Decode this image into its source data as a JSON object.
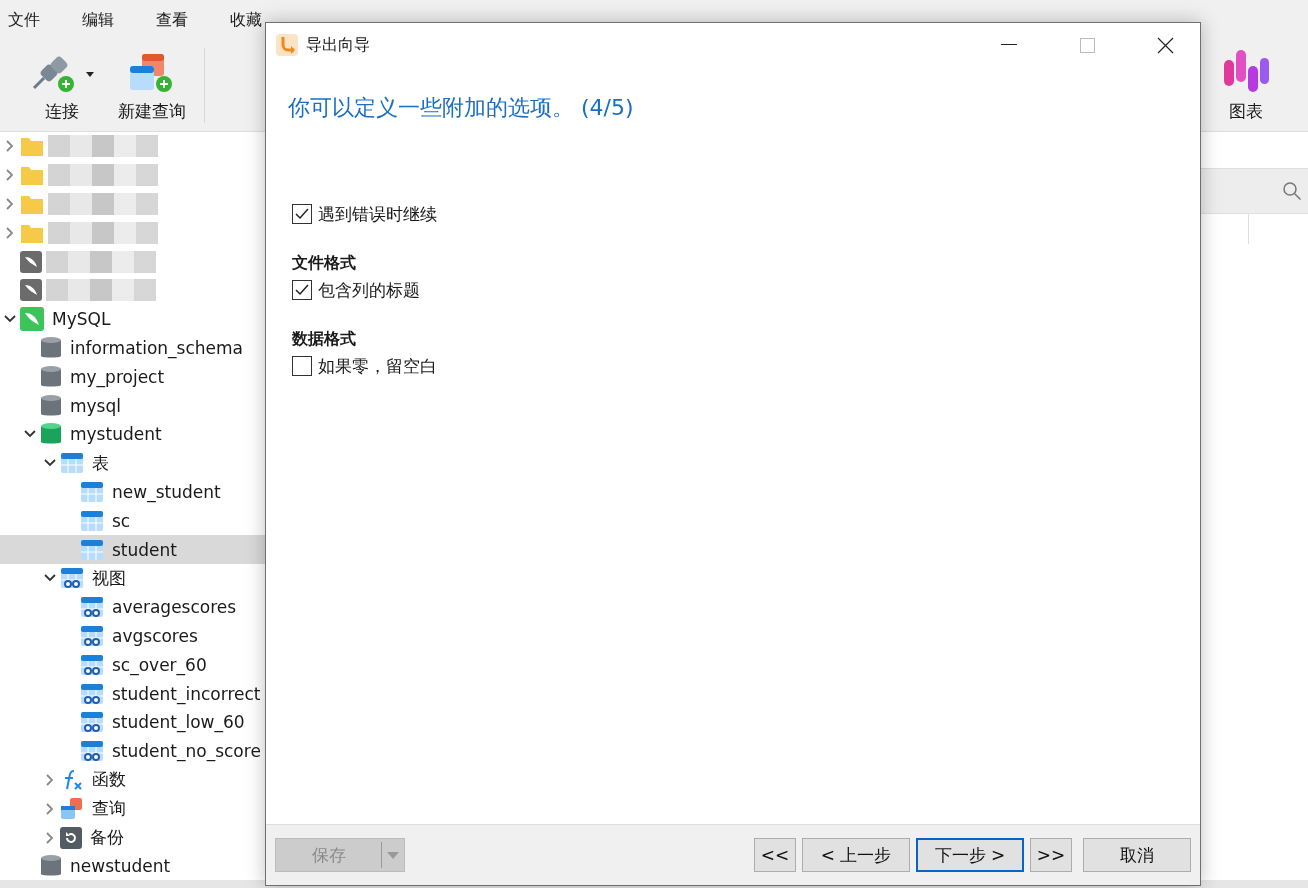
{
  "menu": [
    "文件",
    "编辑",
    "查看",
    "收藏"
  ],
  "toolbar": [
    {
      "label": "连接",
      "kind": "connect",
      "dropdown": true
    },
    {
      "label": "新建查询",
      "kind": "query",
      "dropdown": false
    },
    {
      "label": "图表",
      "kind": "chart",
      "dropdown": false
    }
  ],
  "tree": [
    {
      "kind": "redacted-folder",
      "expanded": false,
      "selected": false
    },
    {
      "kind": "redacted-folder",
      "expanded": false,
      "selected": false
    },
    {
      "kind": "redacted-folder",
      "expanded": false,
      "selected": false
    },
    {
      "kind": "redacted-folder",
      "expanded": false,
      "selected": false
    },
    {
      "kind": "redacted-connection",
      "selected": false
    },
    {
      "kind": "redacted-connection",
      "selected": false
    },
    {
      "kind": "mysql",
      "label": "MySQL",
      "expanded": true,
      "selected": false,
      "children": [
        {
          "kind": "database",
          "label": "information_schema",
          "selected": false
        },
        {
          "kind": "database",
          "label": "my_project",
          "selected": false
        },
        {
          "kind": "database",
          "label": "mysql",
          "selected": false
        },
        {
          "kind": "database-open",
          "label": "mystudent",
          "expanded": true,
          "selected": false,
          "children": [
            {
              "kind": "tables",
              "label": "表",
              "expanded": true,
              "selected": false,
              "children": [
                {
                  "kind": "table",
                  "label": "new_student",
                  "selected": false
                },
                {
                  "kind": "table",
                  "label": "sc",
                  "selected": false
                },
                {
                  "kind": "table",
                  "label": "student",
                  "selected": true
                }
              ]
            },
            {
              "kind": "views",
              "label": "视图",
              "expanded": true,
              "selected": false,
              "children": [
                {
                  "kind": "view",
                  "label": "averagescores",
                  "selected": false
                },
                {
                  "kind": "view",
                  "label": "avgscores",
                  "selected": false
                },
                {
                  "kind": "view",
                  "label": "sc_over_60",
                  "selected": false
                },
                {
                  "kind": "view",
                  "label": "student_incorrect",
                  "selected": false
                },
                {
                  "kind": "view",
                  "label": "student_low_60",
                  "selected": false
                },
                {
                  "kind": "view",
                  "label": "student_no_score",
                  "selected": false
                }
              ]
            },
            {
              "kind": "functions",
              "label": "函数",
              "expanded": false,
              "selected": false
            },
            {
              "kind": "queries",
              "label": "查询",
              "expanded": false,
              "selected": false
            },
            {
              "kind": "backups",
              "label": "备份",
              "expanded": false,
              "selected": false
            }
          ]
        },
        {
          "kind": "database",
          "label": "newstudent",
          "selected": false
        }
      ]
    }
  ],
  "dialog": {
    "title": "导出向导",
    "heading": "你可以定义一些附加的选项。 (4/5)",
    "options": [
      {
        "kind": "checkbox",
        "label": "遇到错误时继续",
        "checked": true
      },
      {
        "kind": "section",
        "label": "文件格式"
      },
      {
        "kind": "checkbox",
        "label": "包含列的标题",
        "checked": true
      },
      {
        "kind": "section",
        "label": "数据格式"
      },
      {
        "kind": "checkbox",
        "label": "如果零，留空白",
        "checked": false
      }
    ],
    "save_button": {
      "label": "保存",
      "disabled": true
    },
    "nav_buttons": [
      {
        "label": "<<",
        "kind": "small",
        "default": false
      },
      {
        "label": "< 上一步",
        "kind": "wide",
        "default": false
      },
      {
        "label": "下一步 >",
        "kind": "wide",
        "default": true
      },
      {
        "label": ">>",
        "kind": "small",
        "default": false
      }
    ],
    "cancel_button": {
      "label": "取消"
    }
  }
}
